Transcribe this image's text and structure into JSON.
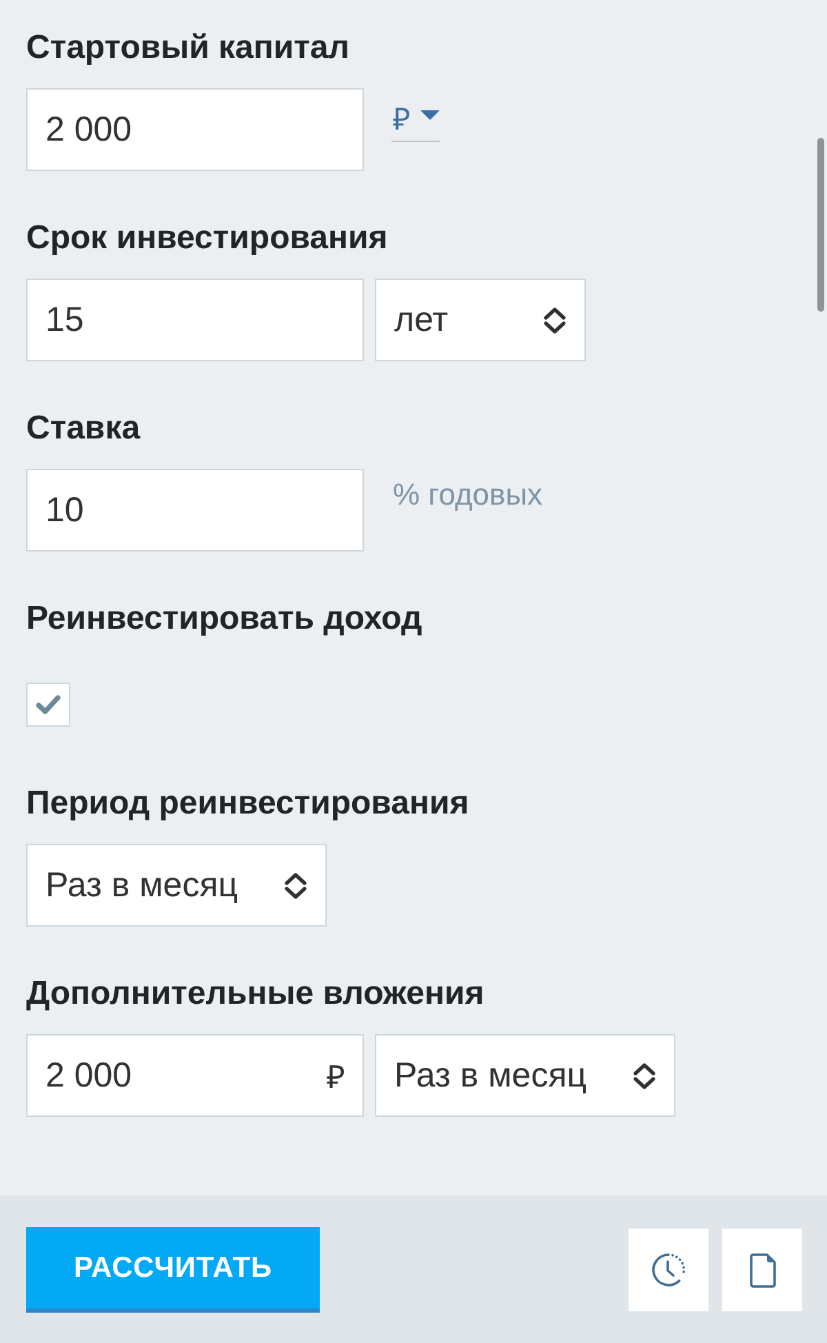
{
  "form": {
    "fields": [
      {
        "label": "Стартовый капитал",
        "controls": [
          {
            "kind": "input",
            "value": "2 000"
          },
          {
            "kind": "dropdown",
            "value": "₽"
          }
        ]
      },
      {
        "label": "Срок инвестирования",
        "controls": [
          {
            "kind": "input",
            "value": "15"
          },
          {
            "kind": "select",
            "value": "лет"
          }
        ]
      },
      {
        "label": "Ставка",
        "controls": [
          {
            "kind": "input",
            "value": "10"
          },
          {
            "kind": "note",
            "text": "% годовых"
          }
        ]
      },
      {
        "label": "Реинвестировать доход",
        "controls": [
          {
            "kind": "checkbox",
            "checked": true
          }
        ]
      },
      {
        "label": "Период реинвестирования",
        "controls": [
          {
            "kind": "select",
            "value": "Раз в месяц"
          }
        ]
      },
      {
        "label": "Дополнительные вложения",
        "controls": [
          {
            "kind": "input",
            "value": "2 000",
            "unit": "₽"
          },
          {
            "kind": "select",
            "value": "Раз в месяц"
          }
        ]
      }
    ]
  },
  "footer": {
    "calculate_button": "РАССЧИТАТЬ"
  }
}
